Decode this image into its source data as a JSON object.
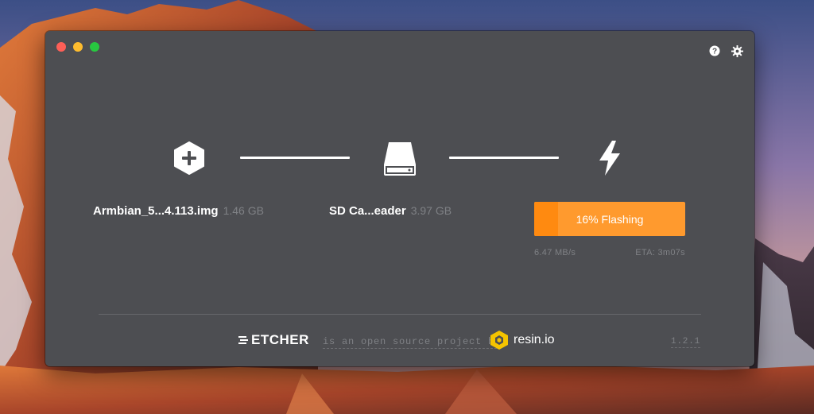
{
  "window": {
    "controls": [
      "close",
      "minimize",
      "maximize"
    ],
    "top_icons": [
      "help-icon",
      "settings-gear-icon"
    ]
  },
  "steps": {
    "image": {
      "icon": "plus-hexagon-icon",
      "name": "Armbian_5...4.113.img",
      "size": "1.46 GB"
    },
    "drive": {
      "icon": "sd-card-drive-icon",
      "name": "SD Ca...eader",
      "size": "3.97 GB"
    },
    "flash": {
      "icon": "lightning-bolt-icon",
      "progress_label": "16% Flashing",
      "progress_percent": 16,
      "speed": "6.47 MB/s",
      "eta": "ETA: 3m07s"
    }
  },
  "footer": {
    "brand": "ETCHER",
    "tagline": "is an open source project by",
    "company": "resin.io",
    "version": "1.2.1"
  },
  "colors": {
    "window_bg": "#4d4e52",
    "accent_orange": "#ff9a2e",
    "muted_text": "#7f8185"
  }
}
